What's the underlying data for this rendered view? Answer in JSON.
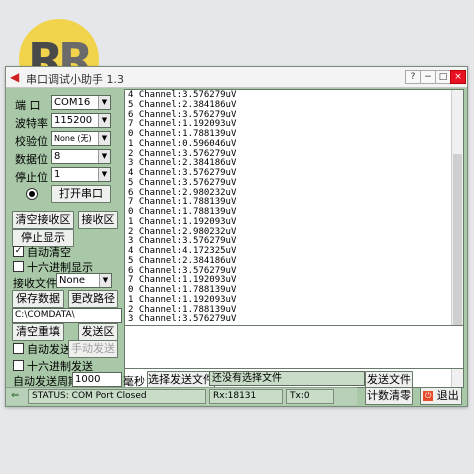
{
  "app": {
    "title": "串口调试小助手 1.3",
    "logo_text": "RR"
  },
  "settings": {
    "port_label": "端 口",
    "port_value": "COM16",
    "baud_label": "波特率",
    "baud_value": "115200",
    "parity_label": "校验位",
    "parity_value": "None (无)",
    "databits_label": "数据位",
    "databits_value": "8",
    "stopbits_label": "停止位",
    "stopbits_value": "1",
    "open_port_label": "打开串口"
  },
  "receive": {
    "clear_receive_label": "清空接收区",
    "receive_area_label": "接收区",
    "stop_display_label": "停止显示",
    "auto_clear_label": "自动清空",
    "auto_clear_checked": true,
    "hex_display_label": "十六进制显示",
    "hex_display_checked": false,
    "recv_file_label": "接收文件",
    "recv_file_value": "None",
    "save_data_label": "保存数据",
    "change_path_label": "更改路径",
    "path_value": "C:\\COMDATA\\"
  },
  "output_lines": [
    "4 Channel:3.576279uV",
    "5 Channel:2.384186uV",
    "6 Channel:3.576279uV",
    "7 Channel:1.192093uV",
    "0 Channel:1.788139uV",
    "1 Channel:0.596046uV",
    "2 Channel:3.576279uV",
    "3 Channel:2.384186uV",
    "4 Channel:3.576279uV",
    "5 Channel:3.576279uV",
    "6 Channel:2.980232uV",
    "7 Channel:1.788139uV",
    "0 Channel:1.788139uV",
    "1 Channel:1.192093uV",
    "2 Channel:2.980232uV",
    "3 Channel:3.576279uV",
    "4 Channel:4.172325uV",
    "5 Channel:2.384186uV",
    "6 Channel:3.576279uV",
    "7 Channel:1.192093uV",
    "0 Channel:1.788139uV",
    "1 Channel:1.192093uV",
    "2 Channel:1.788139uV",
    "3 Channel:3.576279uV"
  ],
  "send": {
    "clear_resend_label": "清空重填",
    "send_area_label": "发送区",
    "auto_send_label": "自动发送",
    "auto_send_checked": false,
    "manual_send_label": "手动发送",
    "hex_send_label": "十六进制发送",
    "hex_send_checked": false,
    "auto_period_label": "自动发送周期",
    "auto_period_value": "1000",
    "ms_label": "毫秒",
    "choose_file_label": "选择发送文件",
    "file_status": "还没有选择文件",
    "send_file_label": "发送文件",
    "count_clear_label": "计数清零",
    "exit_label": "退出"
  },
  "status": {
    "status_text": "STATUS: COM Port Closed",
    "rx_text": "Rx:18131",
    "tx_text": "Tx:0"
  },
  "colors": {
    "panel": "#a8c8a8",
    "logo_yellow": "#f2d13a"
  }
}
